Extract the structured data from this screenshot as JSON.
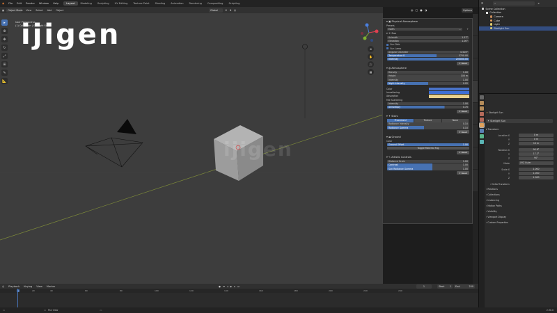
{
  "menu": {
    "items": [
      "File",
      "Edit",
      "Render",
      "Window",
      "Help"
    ],
    "workspaces": [
      "Layout",
      "Modeling",
      "Sculpting",
      "UV Editing",
      "Texture Paint",
      "Shading",
      "Animation",
      "Rendering",
      "Compositing",
      "Scripting"
    ],
    "active_workspace": "Layout",
    "scene_label": "Scene",
    "view_layer_label": "View Layer"
  },
  "viewport": {
    "mode": "Object Mode",
    "header_items": [
      "View",
      "Select",
      "Add",
      "Object"
    ],
    "orientation": "Global",
    "options_label": "Options",
    "info_line1": "User Perspective",
    "info_line2": "(1) Collection | Starlight Sun",
    "logo_text": "ijigen",
    "watermark_text": "ijigen"
  },
  "npanel": {
    "title": "Physical Atmosphere",
    "presets_label": "Presets",
    "preset_value": "Earth",
    "sun": {
      "header": "Sun",
      "azimuth_label": "Azimuth",
      "azimuth": "1.57°",
      "elevation_label": "Elevation",
      "elevation": "1.00°",
      "sun_disk": "Sun Disk",
      "sun_lamp": "Sun Lamp",
      "angular_label": "Angular Diameter",
      "angular": "0.526°",
      "temperature_label": "Temperature K",
      "temperature": "5700.00",
      "intensity_label": "Intensity",
      "intensity": "200000.00",
      "reset": "Reset"
    },
    "atmosphere": {
      "header": "Atmosphere",
      "density_label": "Density",
      "density": "1.00",
      "height_label": "Height",
      "height": "100 m",
      "intensity_label": "Intensity",
      "intensity": "1.00",
      "night_label": "Night Intensity",
      "night": "0.02",
      "color_label": "Color",
      "inscattering_label": "Inscattering",
      "absorption_label": "Absorption",
      "mie_label": "Mie Scattering",
      "mie_intensity_label": "Intensity",
      "mie_intensity": "1.00",
      "anisotropy_label": "Anisotropy",
      "anisotropy": "0.70",
      "reset": "Reset"
    },
    "stars": {
      "header": "Stars",
      "tabs": [
        "Procedural",
        "Texture",
        "None"
      ],
      "radiance_label": "Radiance Intensity",
      "radiance": "0.10",
      "radiance_gamma_label": "Radiance Gamma",
      "radiance_gamma": "0.10",
      "reset": "Reset"
    },
    "ground": {
      "header": "Ground",
      "color_label": "Color",
      "offset_label": "Ground Offset",
      "offset": "1.00",
      "toggle_label": "Toggle Material Fog",
      "reset": "Reset"
    },
    "artistic": {
      "header": "Artistic Controls",
      "distance_label": "Distance Scale",
      "distance": "1.00",
      "contrast_label": "Contrast",
      "contrast": "1.00",
      "saturation_label": "Sun Radiance Gamma",
      "saturation": "1.00",
      "reset": "Reset"
    }
  },
  "outliner": {
    "root": "Scene Collection",
    "items": [
      {
        "name": "Collection",
        "color": "#e0e0e0"
      },
      {
        "name": "Camera",
        "color": "#c98c5b"
      },
      {
        "name": "Cube",
        "color": "#e6a15e"
      },
      {
        "name": "Light",
        "color": "#e6d06e"
      },
      {
        "name": "Starlight Sun",
        "color": "#e6d06e"
      }
    ]
  },
  "properties": {
    "object_name": "Starlight Sun",
    "transform_header": "Transform",
    "location_label": "Location X",
    "location": [
      "0 m",
      "0 m",
      "10 m"
    ],
    "rotation_label": "Rotation X",
    "rotation": [
      "90.8°",
      "17.2°",
      "90°"
    ],
    "mode_label": "Mode",
    "mode_value": "XYZ Euler",
    "scale_label": "Scale X",
    "scale": [
      "1.000",
      "1.000",
      "1.000"
    ],
    "delta_label": "Delta Transform",
    "sections": [
      "Relations",
      "Collections",
      "Instancing",
      "Motion Paths",
      "Visibility",
      "Viewport Display",
      "Custom Properties"
    ]
  },
  "timeline": {
    "menu": [
      "Playback",
      "Keying",
      "View",
      "Marker"
    ],
    "current_frame": "1",
    "start_label": "Start",
    "start": "1",
    "end_label": "End",
    "end": "250",
    "ticks": [
      "0",
      "20",
      "40",
      "60",
      "80",
      "100",
      "120",
      "140",
      "160",
      "180",
      "200",
      "220",
      "240"
    ]
  },
  "status": {
    "hint": "Pan View",
    "version": "2.90.0"
  },
  "colors": {
    "accent": "#4772b3",
    "atm_color1": "#4a73c8",
    "atm_color2": "#3d6fd6",
    "atm_color3": "#e8d08c"
  }
}
